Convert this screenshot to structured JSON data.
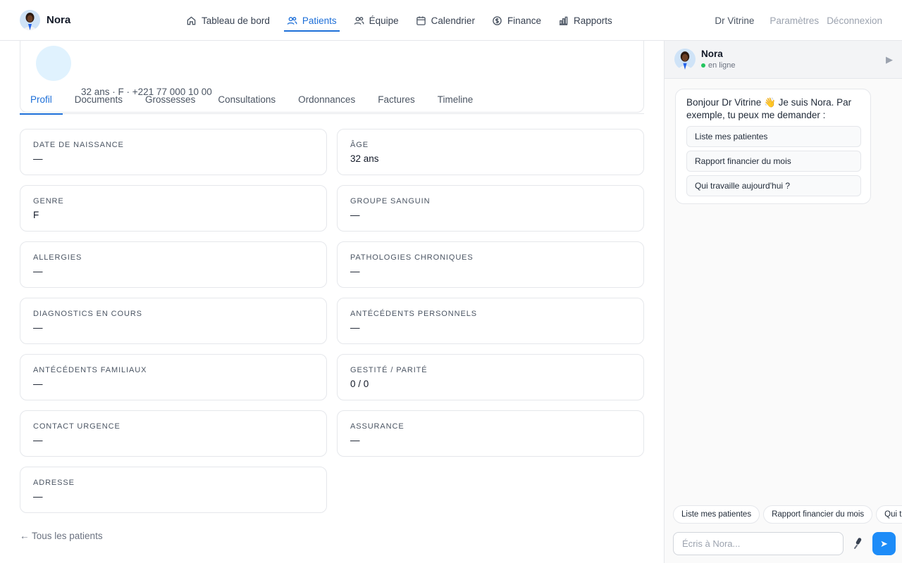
{
  "brand": {
    "name": "Nora"
  },
  "nav": {
    "items": [
      {
        "label": "Tableau de bord",
        "icon": "home-icon"
      },
      {
        "label": "Patients",
        "icon": "users-icon",
        "active": true
      },
      {
        "label": "Équipe",
        "icon": "team-icon"
      },
      {
        "label": "Calendrier",
        "icon": "calendar-icon"
      },
      {
        "label": "Finance",
        "icon": "dollar-icon"
      },
      {
        "label": "Rapports",
        "icon": "bar-chart-icon"
      }
    ],
    "user": "Dr Vitrine",
    "settings": "Paramètres",
    "logout": "Déconnexion"
  },
  "patient": {
    "meta": "32 ans · F · +221 77 000 10 00"
  },
  "tabs": [
    "Profil",
    "Documents",
    "Grossesses",
    "Consultations",
    "Ordonnances",
    "Factures",
    "Timeline"
  ],
  "fields": [
    {
      "label": "Date de naissance",
      "value": "—"
    },
    {
      "label": "Âge",
      "value": "32 ans"
    },
    {
      "label": "Genre",
      "value": "F"
    },
    {
      "label": "Groupe sanguin",
      "value": "—"
    },
    {
      "label": "Allergies",
      "value": "—"
    },
    {
      "label": "Pathologies chroniques",
      "value": "—"
    },
    {
      "label": "Diagnostics en cours",
      "value": "—"
    },
    {
      "label": "Antécédents personnels",
      "value": "—"
    },
    {
      "label": "Antécédents familiaux",
      "value": "—"
    },
    {
      "label": "Gestité / Parité",
      "value": "0 / 0"
    },
    {
      "label": "Contact urgence",
      "value": "—"
    },
    {
      "label": "Assurance",
      "value": "—"
    },
    {
      "label": "Adresse",
      "value": "—"
    }
  ],
  "back_link": "← Tous les patients",
  "chat": {
    "name": "Nora",
    "status": "en ligne",
    "greeting": "Bonjour Dr Vitrine 👋 Je suis Nora. Par exemple, tu peux me demander :",
    "suggestions": [
      "Liste mes patientes",
      "Rapport financier du mois",
      "Qui travaille aujourd'hui ?"
    ],
    "chips": [
      "Liste mes patientes",
      "Rapport financier du mois",
      "Qui travaille aujourd'hui ?"
    ],
    "input_placeholder": "Écris à Nora...",
    "send_icon": "send-icon",
    "mic_icon": "microphone-icon"
  },
  "colors": {
    "accent": "#1d6fd8",
    "send": "#1d8cf8",
    "online": "#22c55e"
  }
}
